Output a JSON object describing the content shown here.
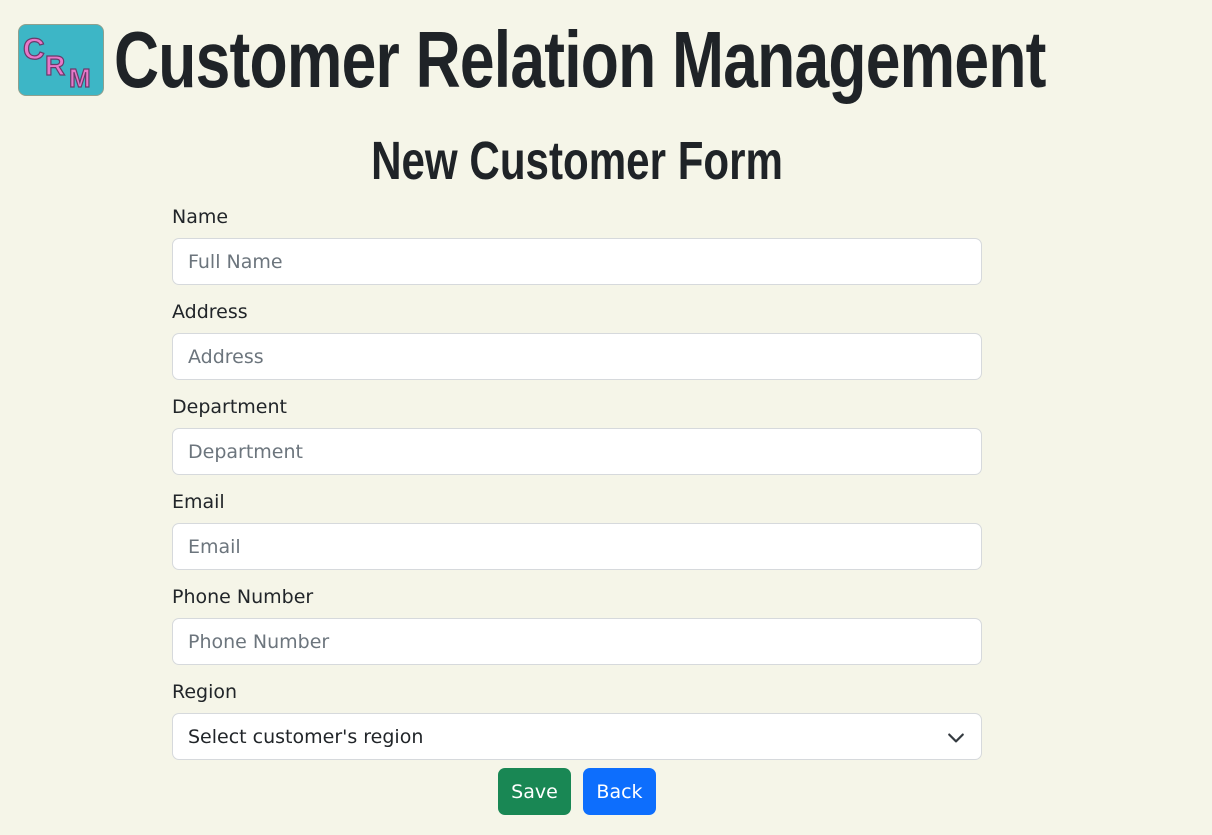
{
  "header": {
    "title": "Customer Relation Management",
    "logo_text": "CRM"
  },
  "form": {
    "title": "New Customer Form",
    "fields": [
      {
        "label": "Name",
        "placeholder": "Full Name",
        "value": ""
      },
      {
        "label": "Address",
        "placeholder": "Address",
        "value": ""
      },
      {
        "label": "Department",
        "placeholder": "Department",
        "value": ""
      },
      {
        "label": "Email",
        "placeholder": "Email",
        "value": ""
      },
      {
        "label": "Phone Number",
        "placeholder": "Phone Number",
        "value": ""
      }
    ],
    "region": {
      "label": "Region",
      "selected": "Select customer's region"
    },
    "buttons": {
      "save": "Save",
      "back": "Back"
    }
  },
  "colors": {
    "background": "#f5f5e8",
    "save": "#198754",
    "back": "#0d6efd",
    "logo_bg": "#3db6c6",
    "logo_letters": "#e878c8"
  },
  "icons": {
    "region_dropdown": "chevron-down-icon"
  }
}
